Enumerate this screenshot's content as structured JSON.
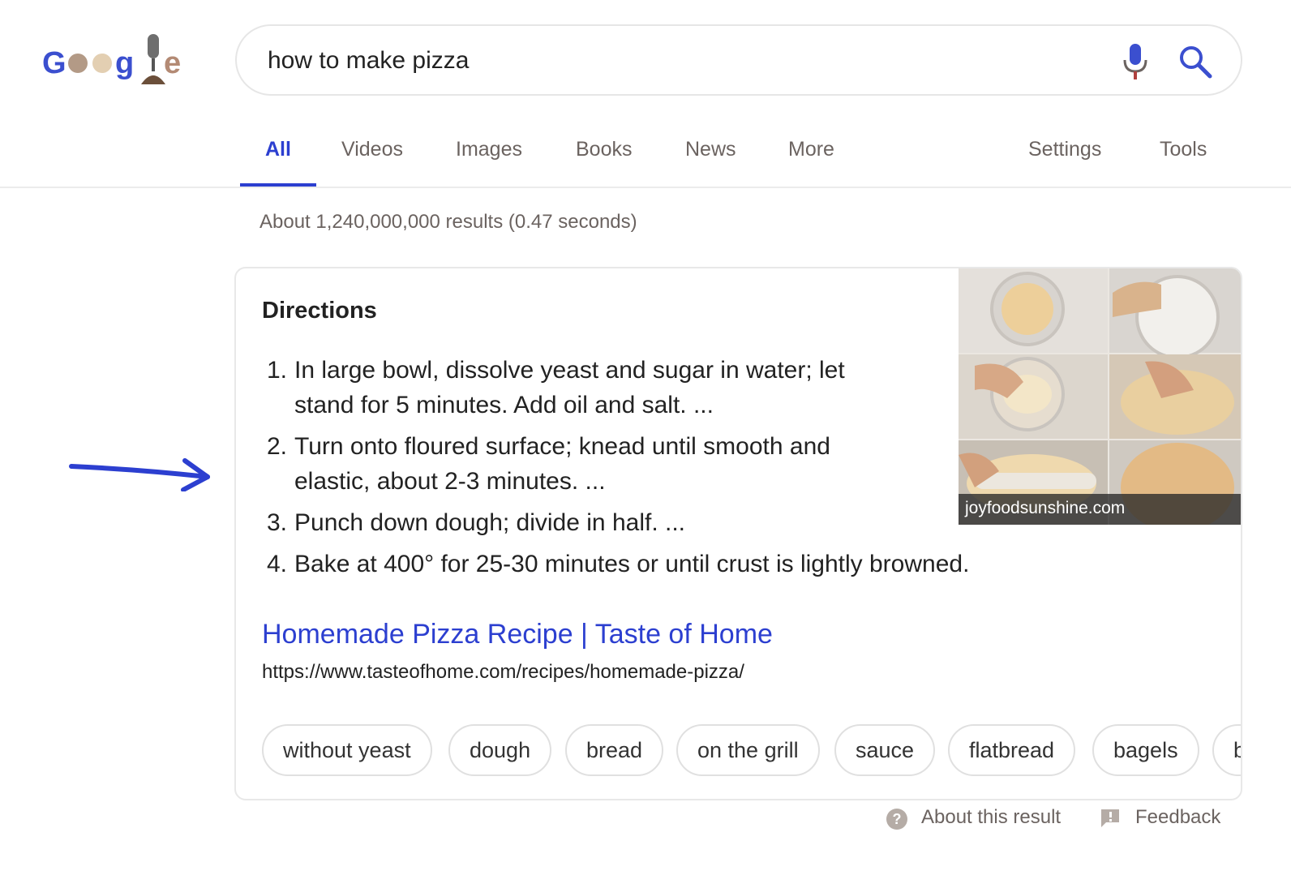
{
  "search": {
    "query": "how to make pizza"
  },
  "tabs": [
    {
      "label": "All"
    },
    {
      "label": "Videos"
    },
    {
      "label": "Images"
    },
    {
      "label": "Books"
    },
    {
      "label": "News"
    },
    {
      "label": "More"
    },
    {
      "label": "Settings"
    },
    {
      "label": "Tools"
    }
  ],
  "results": {
    "stats": "About 1,240,000,000 results (0.47 seconds)"
  },
  "featured_snippet": {
    "heading": "Directions",
    "steps": [
      {
        "num": "1.",
        "text": "In large bowl, dissolve yeast and sugar in water; let stand for 5 minutes. Add oil and salt. ..."
      },
      {
        "num": "2.",
        "text": "Turn onto floured surface; knead until smooth and elastic, about 2-3 minutes. ..."
      },
      {
        "num": "3.",
        "text": "Punch down dough; divide in half. ..."
      },
      {
        "num": "4.",
        "text": "Bake at 400° for 25-30 minutes or until crust is lightly browned."
      }
    ],
    "image_caption": "joyfoodsunshine.com",
    "source_title": "Homemade Pizza Recipe | Taste of Home",
    "source_url": "https://www.tasteofhome.com/recipes/homemade-pizza/",
    "chips": [
      "without yeast",
      "dough",
      "bread",
      "on the grill",
      "sauce",
      "flatbread",
      "bagels",
      "b"
    ]
  },
  "footer": {
    "about": "About this result",
    "feedback": "Feedback"
  },
  "colors": {
    "accent": "#2c3fd0",
    "muted_text": "#6b6360"
  }
}
